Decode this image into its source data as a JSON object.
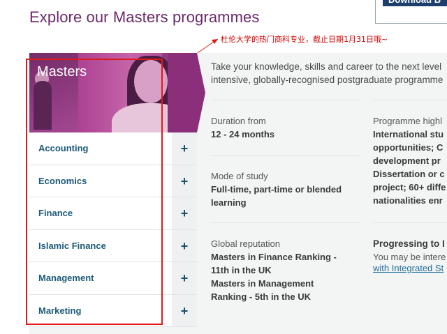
{
  "page_title": "Explore our Masters programmes",
  "download_button": "Download B",
  "annotation": "杜伦大学的热门商科专业，截止日期1月31日哦~",
  "hero": {
    "title": "Masters"
  },
  "menu": [
    {
      "label": "Accounting",
      "plus": "+"
    },
    {
      "label": "Economics",
      "plus": "+"
    },
    {
      "label": "Finance",
      "plus": "+"
    },
    {
      "label": "Islamic Finance",
      "plus": "+"
    },
    {
      "label": "Management",
      "plus": "+"
    },
    {
      "label": "Marketing",
      "plus": "+"
    }
  ],
  "intro": {
    "line1": "Take your knowledge, skills and career to the next level",
    "line2": "intensive, globally-recognised postgraduate programme"
  },
  "details": {
    "duration_label": "Duration from",
    "duration_value": "12 - 24 months",
    "mode_label": "Mode of study",
    "mode_value1": "Full-time, part-time or blended",
    "mode_value2": "learning",
    "reputation_label": "Global reputation",
    "reputation_lines": [
      "Masters in Finance Ranking -",
      "11th in the UK",
      "Masters in Management",
      "Ranking - 5th in the UK"
    ]
  },
  "highlights": {
    "label": "Programme highl",
    "lines": [
      "International stu",
      "opportunities; C",
      "development pr",
      "Dissertation or c",
      "project; 60+ diffe",
      "nationalities enr"
    ]
  },
  "progressing": {
    "title": "Progressing to I",
    "line1": "You may be intere",
    "link": "with Integrated St"
  },
  "colors": {
    "brand_purple": "#8c2f7b",
    "link_blue": "#1d5a78",
    "annotation_red": "#e01a1a"
  }
}
